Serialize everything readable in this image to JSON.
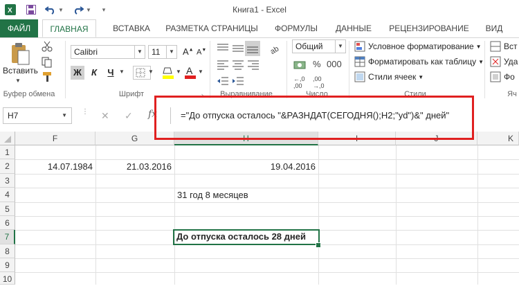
{
  "window": {
    "title": "Книга1 - Excel"
  },
  "tabs": [
    "ФАЙЛ",
    "ГЛАВНАЯ",
    "ВСТАВКА",
    "РАЗМЕТКА СТРАНИЦЫ",
    "ФОРМУЛЫ",
    "ДАННЫЕ",
    "РЕЦЕНЗИРОВАНИЕ",
    "ВИД"
  ],
  "ribbon": {
    "paste_label": "Вставить",
    "font_name": "Calibri",
    "font_size": "11",
    "bold": "Ж",
    "italic": "К",
    "underline": "Ч",
    "number_format": "Общий",
    "conditional_formatting": "Условное форматирование",
    "format_as_table": "Форматировать как таблицу",
    "cell_styles": "Стили ячеек",
    "insert_cut": "Вст",
    "delete_cut": "Уда",
    "format_cut": "Фо",
    "groups": {
      "clipboard": "Буфер обмена",
      "font": "Шрифт",
      "alignment": "Выравнивание",
      "number": "Число",
      "styles": "Стили",
      "cells": "Яч"
    }
  },
  "formula_bar": {
    "name_box": "H7",
    "fx": "fx",
    "formula": "=\"До отпуска осталось \"&РАЗНДАТ(СЕГОДНЯ();H2;\"yd\")&\" дней\""
  },
  "columns": [
    "F",
    "G",
    "H",
    "I",
    "J",
    "K"
  ],
  "rows": [
    "1",
    "2",
    "3",
    "4",
    "5",
    "6",
    "7",
    "8",
    "9",
    "10"
  ],
  "cells": {
    "F2": "14.07.1984",
    "G2": "21.03.2016",
    "H2": "19.04.2016",
    "H4": "31 год 8 месяцев",
    "H7": "До отпуска осталось 28 дней"
  },
  "colors": {
    "accent": "#217346",
    "highlight": "#e02020"
  }
}
